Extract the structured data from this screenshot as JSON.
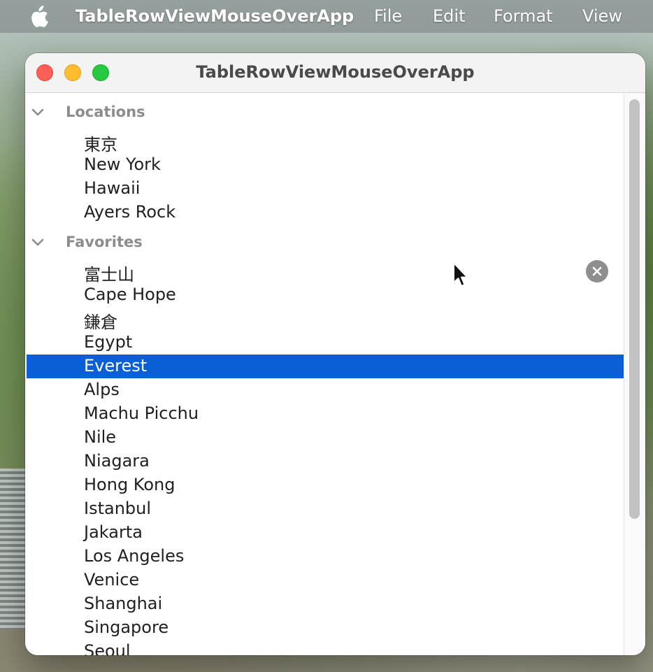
{
  "menubar": {
    "app": "TableRowViewMouseOverApp",
    "file": "File",
    "edit": "Edit",
    "format": "Format",
    "view": "View"
  },
  "window": {
    "title": "TableRowViewMouseOverApp"
  },
  "groups": [
    {
      "label": "Locations",
      "expanded": true,
      "items": [
        "東京",
        "New York",
        "Hawaii",
        "Ayers Rock"
      ]
    },
    {
      "label": "Favorites",
      "expanded": true,
      "items": [
        "富士山",
        "Cape Hope",
        "鎌倉",
        "Egypt",
        "Everest",
        "Alps",
        "Machu Picchu",
        "Nile",
        "Niagara",
        "Hong Kong",
        "Istanbul",
        "Jakarta",
        "Los Angeles",
        "Venice",
        "Shanghai",
        "Singapore",
        "Seoul"
      ]
    }
  ],
  "selected_item": "Everest",
  "hovered_item": "富士山",
  "colors": {
    "selection": "#0a5fd6",
    "close": "#fe5f57",
    "minimize": "#febc2e",
    "maximize": "#28c840"
  }
}
